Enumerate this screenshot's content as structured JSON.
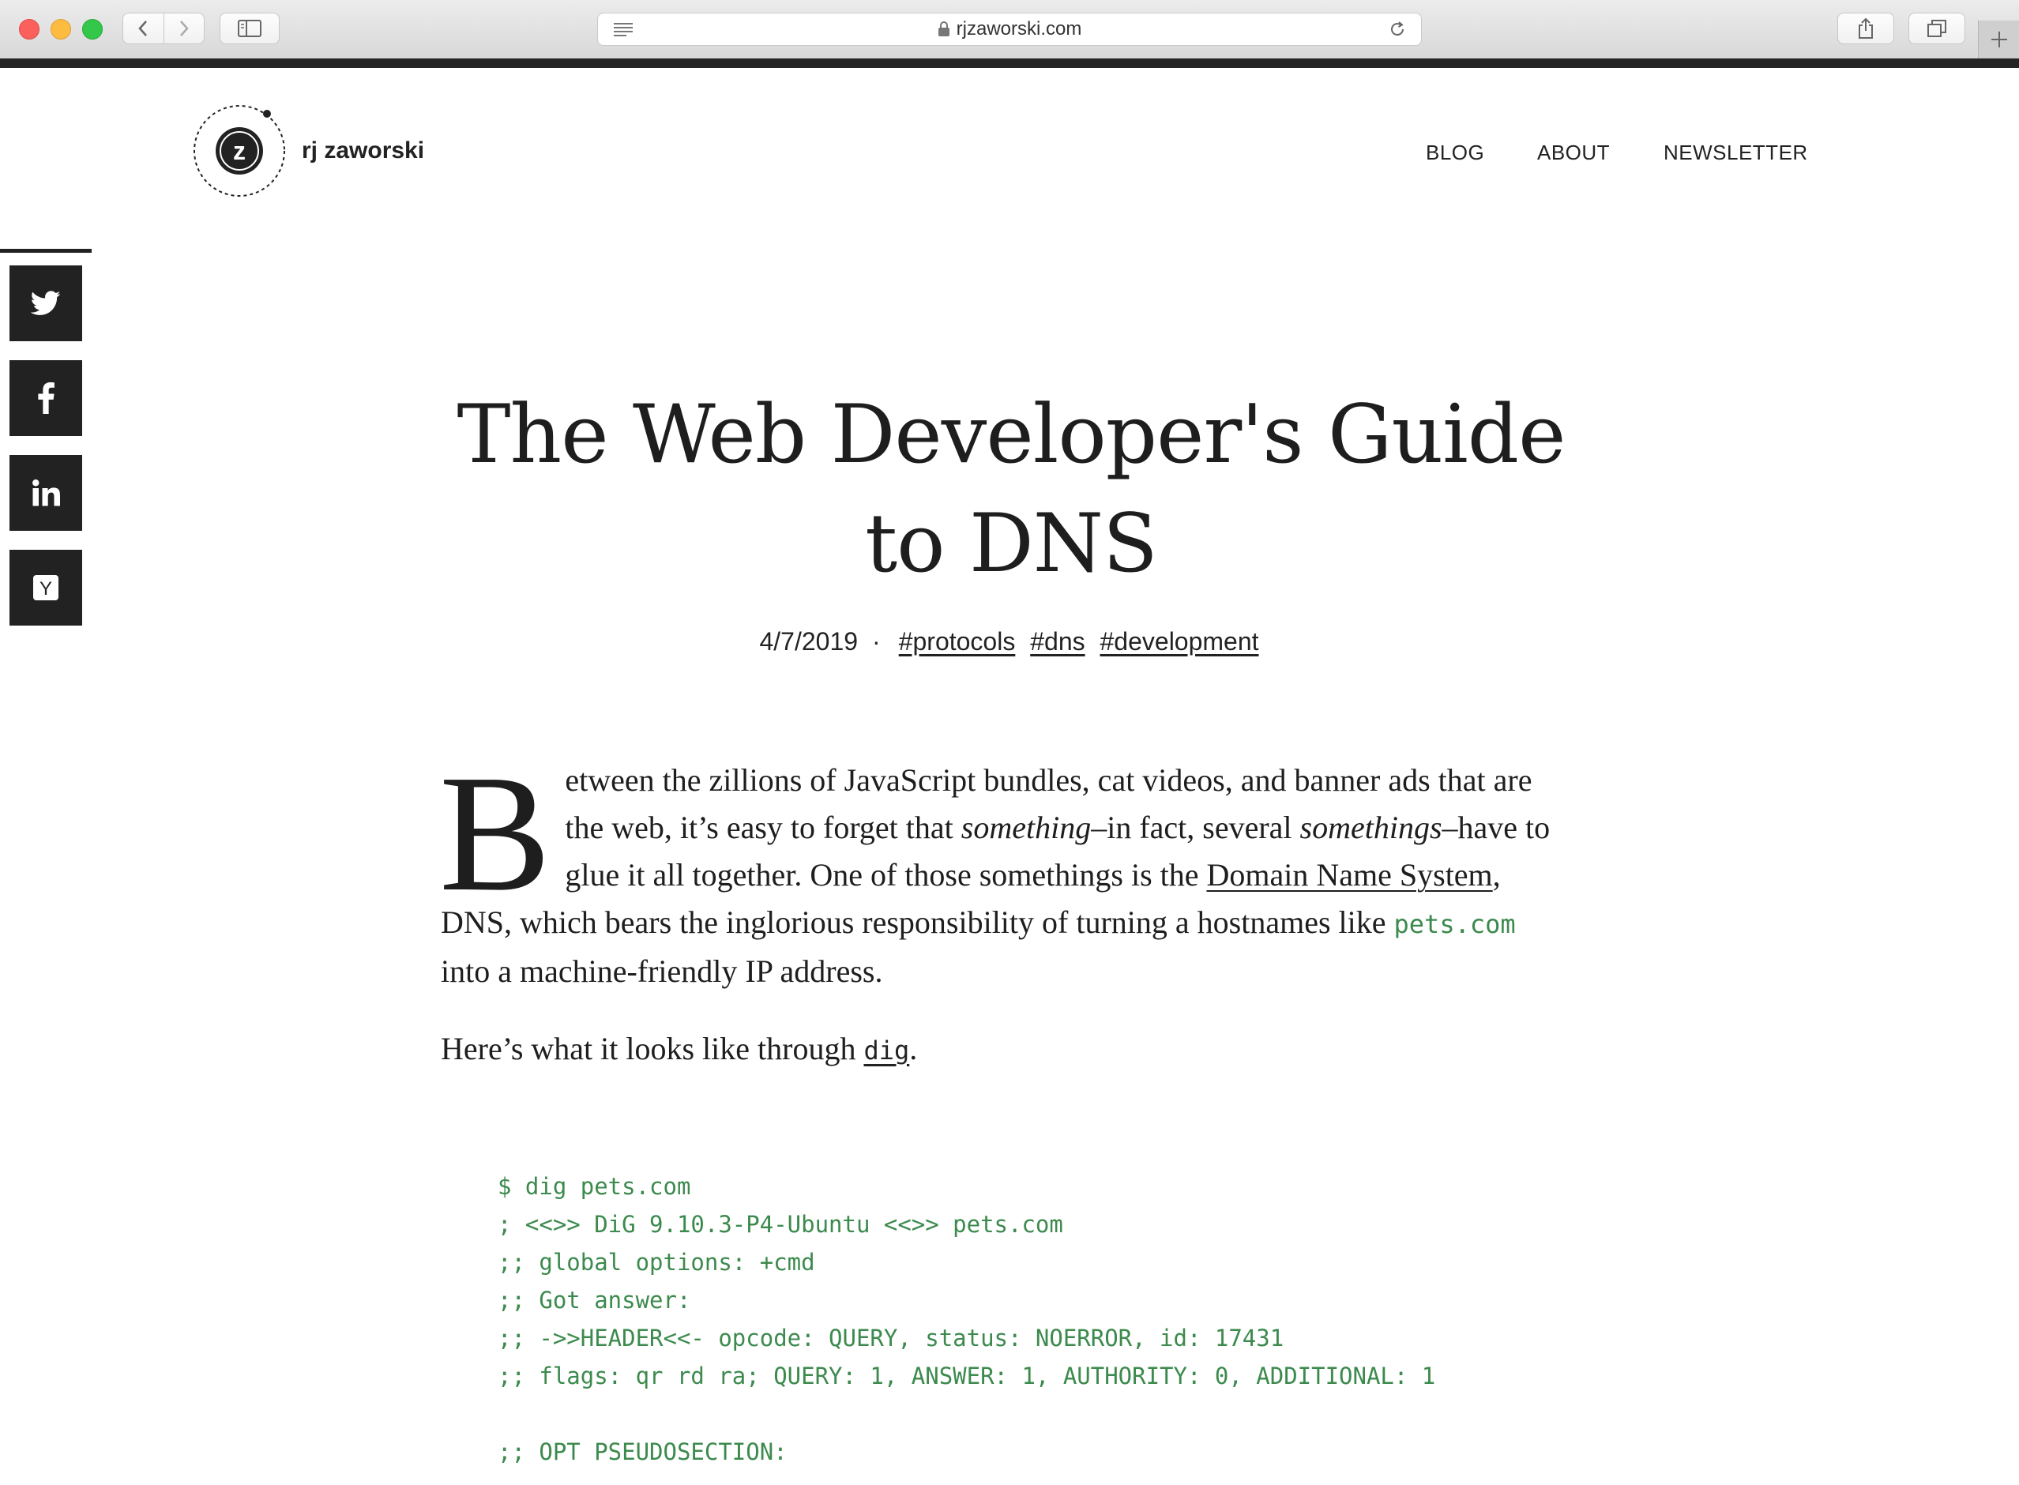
{
  "browser": {
    "url": "rjzaworski.com"
  },
  "site": {
    "brand": "rj zaworski",
    "logo_letter": "z",
    "nav": [
      "BLOG",
      "ABOUT",
      "NEWSLETTER"
    ]
  },
  "social": [
    "twitter-icon",
    "facebook-icon",
    "linkedin-icon",
    "hackernews-icon"
  ],
  "social_hn_letter": "Y",
  "article": {
    "title": "The Web Developer's Guide to DNS",
    "date": "4/7/2019",
    "tags": [
      "#protocols",
      "#dns",
      "#development"
    ],
    "dropcap": "B",
    "p1": {
      "a": "etween the zillions of JavaScript bundles, cat videos, and banner ads that are the web, it’s easy to forget that ",
      "em1": "something",
      "b": "–in fact, several ",
      "em2": "somethings",
      "c": "–have to glue it all together. One of those somethings is the ",
      "link": "Domain Name System",
      "d": ", DNS, which bears the inglorious responsibility of turning a hostnames like ",
      "code": "pets.com",
      "e": " into a machine-friendly IP address."
    },
    "p2": {
      "a": "Here’s what it looks like through ",
      "code": "dig",
      "b": "."
    },
    "code_lines": [
      "$ dig pets.com",
      "; <<>> DiG 9.10.3-P4-Ubuntu <<>> pets.com",
      ";; global options: +cmd",
      ";; Got answer:",
      ";; ->>HEADER<<- opcode: QUERY, status: NOERROR, id: 17431",
      ";; flags: qr rd ra; QUERY: 1, ANSWER: 1, AUTHORITY: 0, ADDITIONAL: 1",
      "",
      ";; OPT PSEUDOSECTION:"
    ]
  },
  "colors": {
    "code_green": "#3c8a4d",
    "ink": "#1e1e1e",
    "social_bg": "#222222"
  }
}
